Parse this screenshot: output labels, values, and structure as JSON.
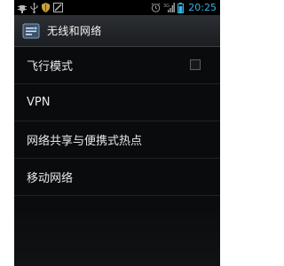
{
  "statusbar": {
    "time": "20:25",
    "left_icons": [
      "usb-debug-icon",
      "usb-icon",
      "shield-icon",
      "notification-icon"
    ],
    "right_icons": [
      "alarm-icon",
      "signal-icon",
      "battery-icon"
    ],
    "accent": "#33b5e5"
  },
  "actionbar": {
    "title": "无线和网络",
    "icon": "settings-app-icon"
  },
  "settings": {
    "items": [
      {
        "label": "飞行模式",
        "has_checkbox": true,
        "checked": false
      },
      {
        "label": "VPN"
      },
      {
        "label": "网络共享与便携式热点"
      },
      {
        "label": "移动网络"
      }
    ]
  }
}
